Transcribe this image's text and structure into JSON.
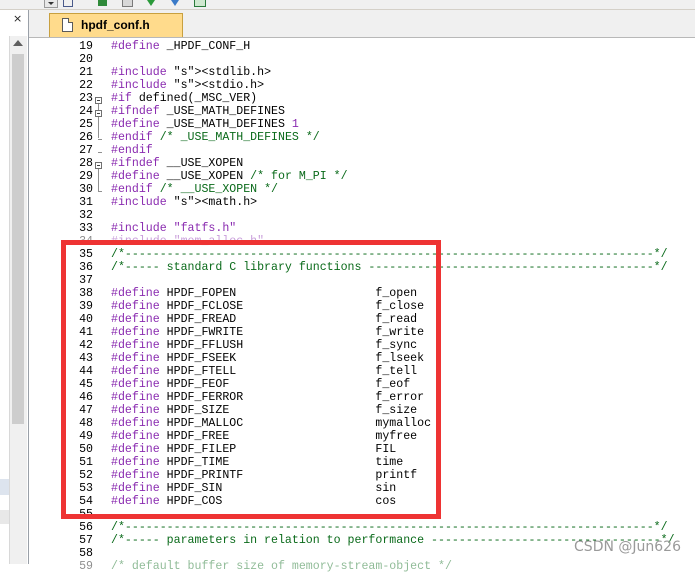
{
  "tab": {
    "label": "hpdf_conf.h"
  },
  "left_panel": {
    "close_glyph": "×"
  },
  "watermark": "CSDN @Jun626",
  "colors": {
    "keyword": "#8a2bb0",
    "comment": "#0a6a1a",
    "highlight": "#ee3333",
    "tab": "#ffdb8c"
  },
  "lines": [
    {
      "num": "19",
      "code": "#define _HPDF_CONF_H"
    },
    {
      "num": "20",
      "code": ""
    },
    {
      "num": "21",
      "code": "#include <stdlib.h>"
    },
    {
      "num": "22",
      "code": "#include <stdio.h>"
    },
    {
      "num": "23",
      "code": "#if defined(_MSC_VER)"
    },
    {
      "num": "24",
      "code": "#ifndef _USE_MATH_DEFINES"
    },
    {
      "num": "25",
      "code": "#define _USE_MATH_DEFINES 1"
    },
    {
      "num": "26",
      "code": "#endif /* _USE_MATH_DEFINES */"
    },
    {
      "num": "27",
      "code": "#endif"
    },
    {
      "num": "28",
      "code": "#ifndef __USE_XOPEN"
    },
    {
      "num": "29",
      "code": "#define __USE_XOPEN /* for M_PI */"
    },
    {
      "num": "30",
      "code": "#endif /* __USE_XOPEN */"
    },
    {
      "num": "31",
      "code": "#include <math.h>"
    },
    {
      "num": "32",
      "code": ""
    },
    {
      "num": "33",
      "code": "#include \"fatfs.h\""
    },
    {
      "num": "34",
      "code": "#include \"mem_alloc.h\""
    },
    {
      "num": "35",
      "code": "/*----------------------------------------------------------------------------*/"
    },
    {
      "num": "36",
      "code": "/*----- standard C library functions -----------------------------------------*/"
    },
    {
      "num": "37",
      "code": ""
    },
    {
      "num": "38",
      "code": "#define HPDF_FOPEN                    f_open"
    },
    {
      "num": "39",
      "code": "#define HPDF_FCLOSE                   f_close"
    },
    {
      "num": "40",
      "code": "#define HPDF_FREAD                    f_read"
    },
    {
      "num": "41",
      "code": "#define HPDF_FWRITE                   f_write"
    },
    {
      "num": "42",
      "code": "#define HPDF_FFLUSH                   f_sync"
    },
    {
      "num": "43",
      "code": "#define HPDF_FSEEK                    f_lseek"
    },
    {
      "num": "44",
      "code": "#define HPDF_FTELL                    f_tell"
    },
    {
      "num": "45",
      "code": "#define HPDF_FEOF                     f_eof"
    },
    {
      "num": "46",
      "code": "#define HPDF_FERROR                   f_error"
    },
    {
      "num": "47",
      "code": "#define HPDF_SIZE                     f_size"
    },
    {
      "num": "48",
      "code": "#define HPDF_MALLOC                   mymalloc"
    },
    {
      "num": "49",
      "code": "#define HPDF_FREE                     myfree"
    },
    {
      "num": "50",
      "code": "#define HPDF_FILEP                    FIL"
    },
    {
      "num": "51",
      "code": "#define HPDF_TIME                     time"
    },
    {
      "num": "52",
      "code": "#define HPDF_PRINTF                   printf"
    },
    {
      "num": "53",
      "code": "#define HPDF_SIN                      sin"
    },
    {
      "num": "54",
      "code": "#define HPDF_COS                      cos"
    },
    {
      "num": "55",
      "code": ""
    },
    {
      "num": "56",
      "code": "/*----------------------------------------------------------------------------*/"
    },
    {
      "num": "57",
      "code": "/*----- parameters in relation to performance ---------------------------------*/"
    },
    {
      "num": "58",
      "code": ""
    },
    {
      "num": "59",
      "code": "/* default buffer size of memory-stream-object */"
    }
  ]
}
